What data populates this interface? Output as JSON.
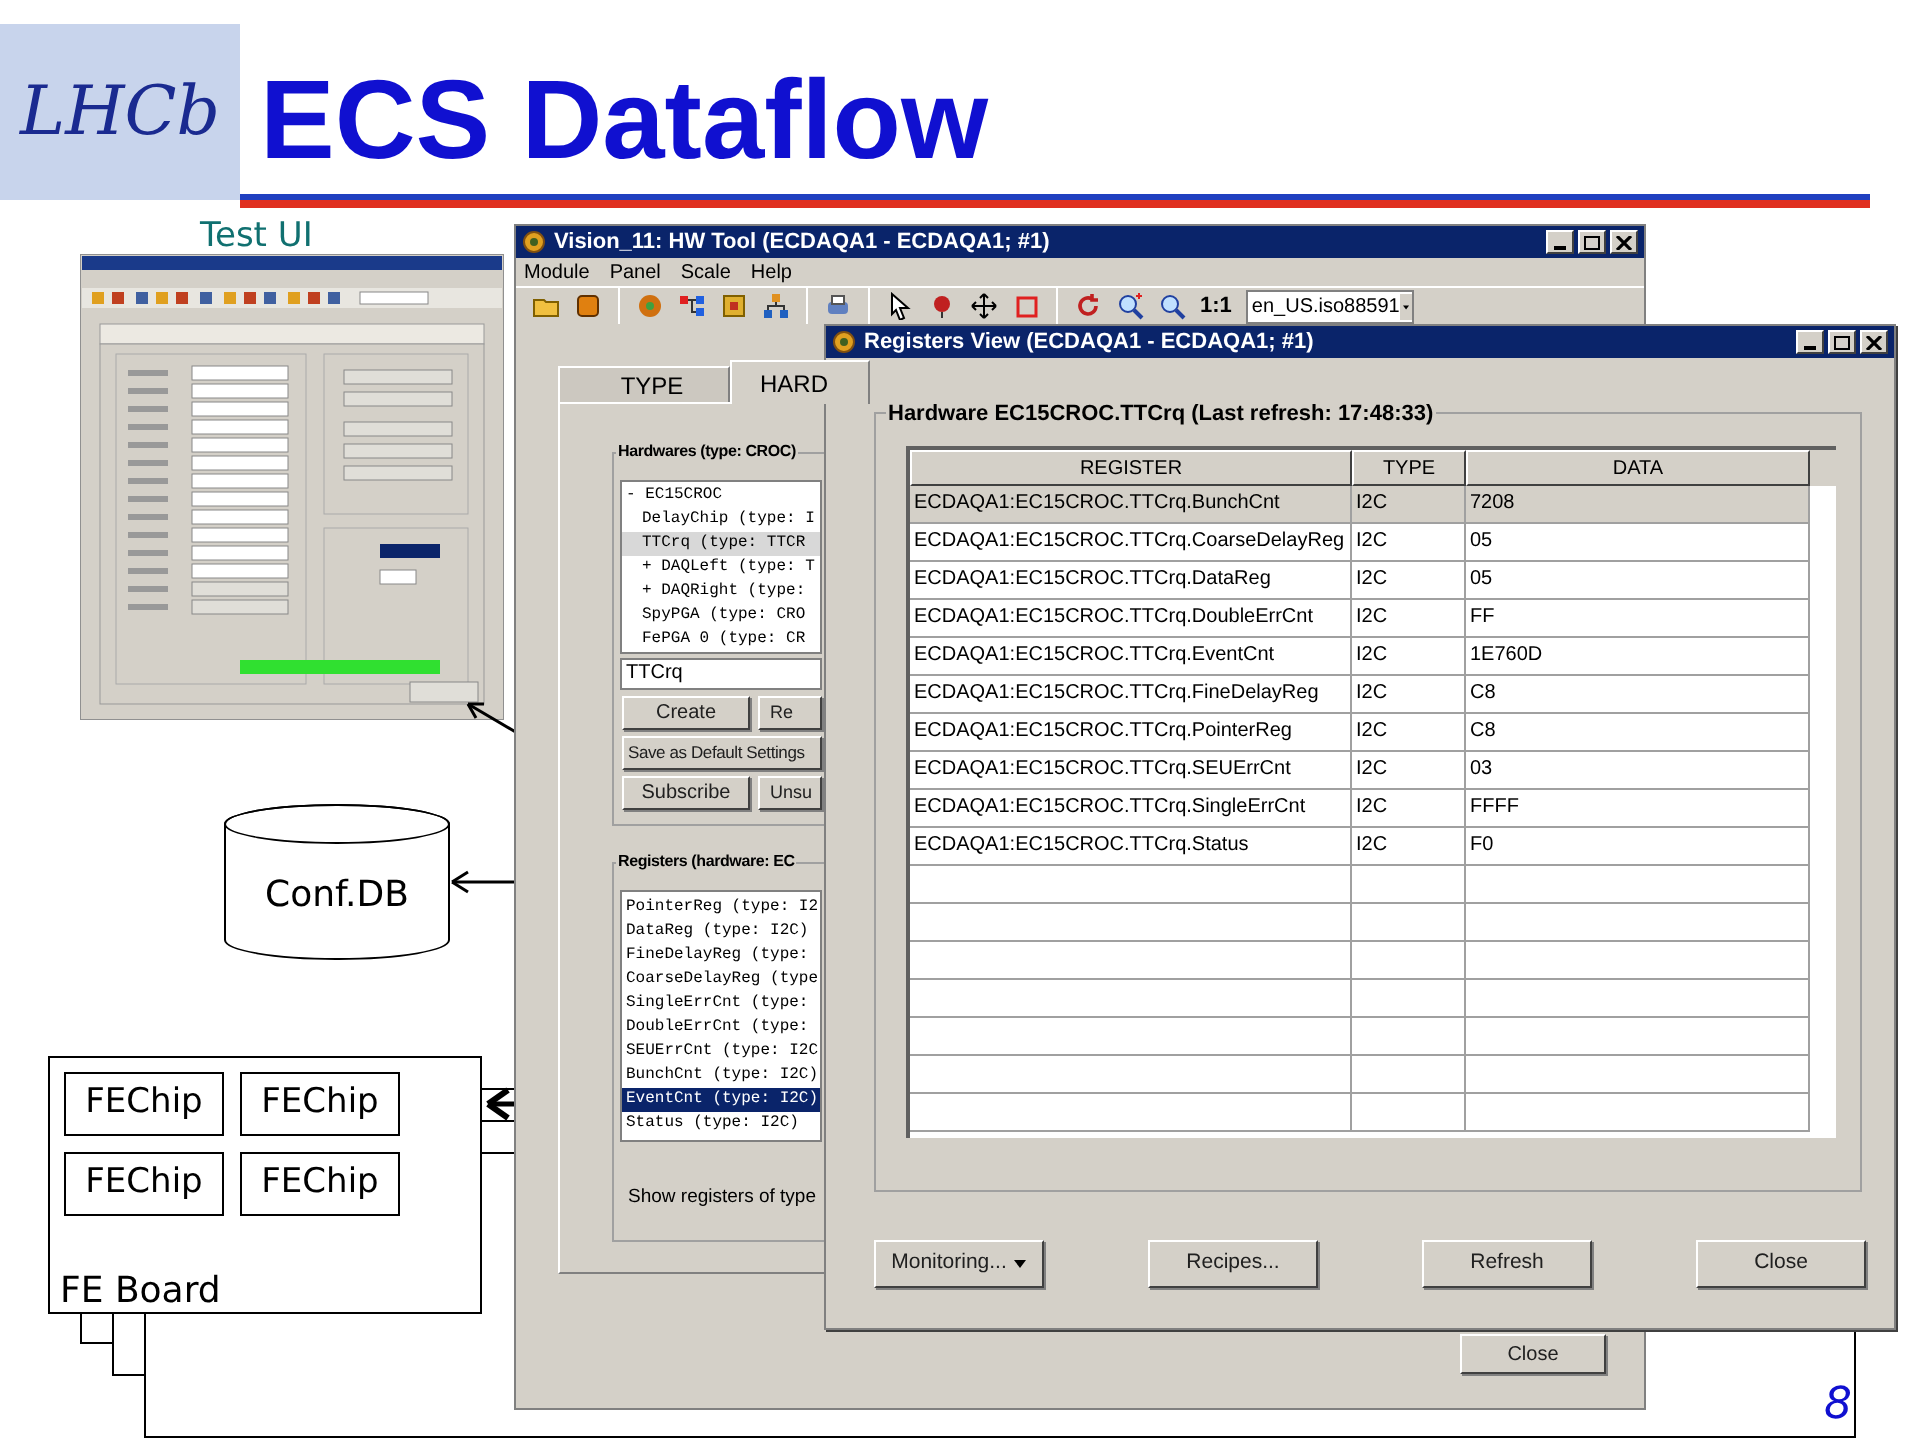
{
  "slide": {
    "logo": "LHCb",
    "title": "ECS Dataflow",
    "page": "8"
  },
  "test_ui": {
    "label": "Test UI"
  },
  "diagram": {
    "database": "Conf.DB",
    "board": {
      "label": "FE Board",
      "chips": [
        "FEChip",
        "FEChip",
        "FEChip",
        "FEChip"
      ]
    }
  },
  "hw_tool": {
    "title": "Vision_11: HW Tool (ECDAQA1 - ECDAQA1; #1)",
    "menu": [
      "Module",
      "Panel",
      "Scale",
      "Help"
    ],
    "zoom_label": "1:1",
    "locale": "en_US.iso88591",
    "tabs": [
      {
        "label": "TYPE",
        "selected": false
      },
      {
        "label": "HARD",
        "selected": true
      }
    ],
    "hardwares": {
      "legend": "Hardwares (type: CROC)",
      "tree": [
        {
          "label": "- EC15CROC",
          "selected": false,
          "children": [
            {
              "label": "DelayChip (type: I",
              "selected": false
            },
            {
              "label": "TTCrq (type: TTCR",
              "selected": true
            },
            {
              "label": "+ DAQLeft (type: T",
              "selected": false
            },
            {
              "label": "+ DAQRight (type:",
              "selected": false
            },
            {
              "label": "SpyPGA (type: CRO",
              "selected": false
            },
            {
              "label": "FePGA 0 (type: CR",
              "selected": false
            }
          ]
        }
      ],
      "name_value": "TTCrq",
      "button_rows": [
        [
          "Create",
          "Re"
        ],
        [
          "Save as Default Settings"
        ],
        [
          "Subscribe",
          "Unsu"
        ]
      ]
    },
    "registers": {
      "legend": "Registers (hardware: EC",
      "items": [
        {
          "label": "PointerReg (type: I2",
          "selected": false
        },
        {
          "label": "DataReg (type: I2C)",
          "selected": false
        },
        {
          "label": "FineDelayReg (type:",
          "selected": false
        },
        {
          "label": "CoarseDelayReg (type",
          "selected": false
        },
        {
          "label": "SingleErrCnt (type:",
          "selected": false
        },
        {
          "label": "DoubleErrCnt (type:",
          "selected": false
        },
        {
          "label": "SEUErrCnt (type: I2C",
          "selected": false
        },
        {
          "label": "BunchCnt (type: I2C)",
          "selected": false
        },
        {
          "label": "EventCnt (type: I2C)",
          "selected": true
        },
        {
          "label": "Status (type: I2C)",
          "selected": false
        }
      ],
      "note": "Show registers of type"
    },
    "close": "Close"
  },
  "registers_view": {
    "title": "Registers View (ECDAQA1 - ECDAQA1; #1)",
    "legend": "Hardware EC15CROC.TTCrq (Last refresh: 17:48:33)",
    "columns": [
      "REGISTER",
      "TYPE",
      "DATA"
    ],
    "rows": [
      {
        "cells": [
          "ECDAQA1:EC15CROC.TTCrq.BunchCnt",
          "I2C",
          "7208"
        ],
        "selected": true
      },
      {
        "cells": [
          "ECDAQA1:EC15CROC.TTCrq.CoarseDelayReg",
          "I2C",
          "05"
        ],
        "selected": false
      },
      {
        "cells": [
          "ECDAQA1:EC15CROC.TTCrq.DataReg",
          "I2C",
          "05"
        ],
        "selected": false
      },
      {
        "cells": [
          "ECDAQA1:EC15CROC.TTCrq.DoubleErrCnt",
          "I2C",
          "FF"
        ],
        "selected": false
      },
      {
        "cells": [
          "ECDAQA1:EC15CROC.TTCrq.EventCnt",
          "I2C",
          "1E760D"
        ],
        "selected": false
      },
      {
        "cells": [
          "ECDAQA1:EC15CROC.TTCrq.FineDelayReg",
          "I2C",
          "C8"
        ],
        "selected": false
      },
      {
        "cells": [
          "ECDAQA1:EC15CROC.TTCrq.PointerReg",
          "I2C",
          "C8"
        ],
        "selected": false
      },
      {
        "cells": [
          "ECDAQA1:EC15CROC.TTCrq.SEUErrCnt",
          "I2C",
          "03"
        ],
        "selected": false
      },
      {
        "cells": [
          "ECDAQA1:EC15CROC.TTCrq.SingleErrCnt",
          "I2C",
          "FFFF"
        ],
        "selected": false
      },
      {
        "cells": [
          "ECDAQA1:EC15CROC.TTCrq.Status",
          "I2C",
          "F0"
        ],
        "selected": false
      }
    ],
    "buttons": [
      {
        "label": "Monitoring...",
        "kind": "menu"
      },
      {
        "label": "Recipes...",
        "kind": "plain"
      },
      {
        "label": "Refresh",
        "kind": "plain"
      },
      {
        "label": "Close",
        "kind": "plain"
      }
    ]
  }
}
